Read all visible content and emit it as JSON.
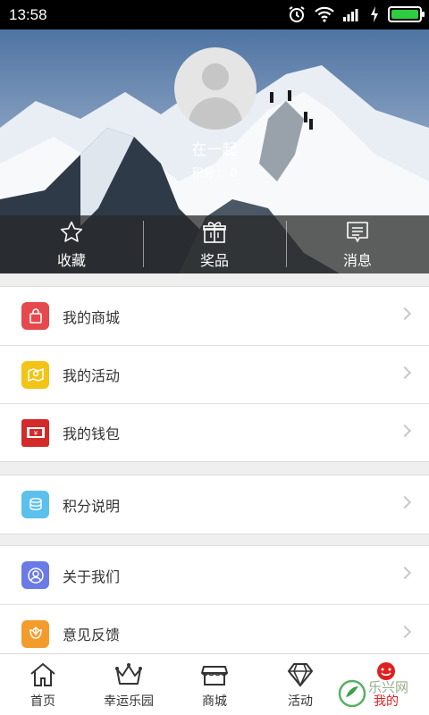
{
  "status_bar": {
    "time": "13:58"
  },
  "profile": {
    "username": "在一起",
    "points_label": "积分",
    "points_separator": "：",
    "points_value": "0"
  },
  "quick_actions": [
    {
      "label": "收藏",
      "icon": "star-icon"
    },
    {
      "label": "奖品",
      "icon": "gift-icon"
    },
    {
      "label": "消息",
      "icon": "message-icon"
    }
  ],
  "menu": {
    "my_mall": {
      "label": "我的商城",
      "icon": "shopping-bag-icon",
      "color": "#e5484d"
    },
    "my_activity": {
      "label": "我的活动",
      "icon": "location-map-icon",
      "color": "#f2c416"
    },
    "my_wallet": {
      "label": "我的钱包",
      "icon": "wallet-icon",
      "color": "#d42a2a"
    },
    "points_info": {
      "label": "积分说明",
      "icon": "coins-icon",
      "color": "#5bc0eb"
    },
    "about_us": {
      "label": "关于我们",
      "icon": "user-circle-icon",
      "color": "#6a7be8"
    },
    "feedback": {
      "label": "意见反馈",
      "icon": "flower-icon",
      "color": "#f39c2c"
    }
  },
  "tabs": [
    {
      "label": "首页",
      "icon": "home-icon"
    },
    {
      "label": "幸运乐园",
      "icon": "crown-icon"
    },
    {
      "label": "商城",
      "icon": "store-icon"
    },
    {
      "label": "活动",
      "icon": "diamond-icon"
    },
    {
      "label": "我的",
      "icon": "smiley-icon",
      "active": true
    }
  ],
  "watermark": {
    "brand": "乐兴网"
  }
}
